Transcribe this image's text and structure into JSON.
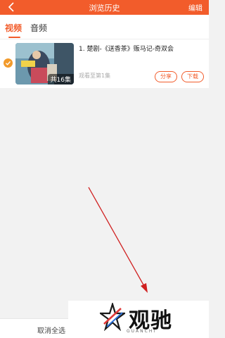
{
  "header": {
    "title": "浏览历史",
    "edit_label": "编辑"
  },
  "tabs": [
    {
      "label": "视频"
    },
    {
      "label": "音频"
    }
  ],
  "history_items": [
    {
      "title": "1. 楚剧-《送香茶》贩马记-奇双会",
      "episode_badge": "共16集",
      "progress": "观看至第1集",
      "share_label": "分享",
      "download_label": "下载"
    }
  ],
  "bottom_bar": {
    "deselect_all": "取消全选"
  },
  "watermark": {
    "brand": "观驰",
    "sub": "GUANCHI"
  },
  "colors": {
    "accent": "#f25c2b",
    "check": "#f29a2b",
    "annotation_arrow": "#d02020"
  },
  "icons": {
    "back": "chevron-left-icon",
    "check": "checkmark-circle-icon"
  }
}
